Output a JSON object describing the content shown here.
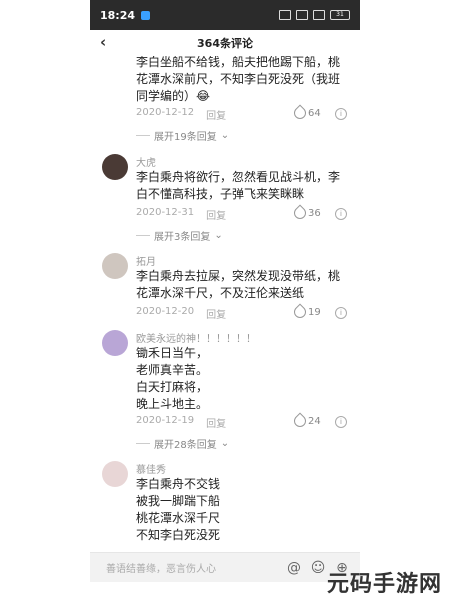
{
  "status": {
    "time": "18:24",
    "battery": "31"
  },
  "header": {
    "title": "364条评论"
  },
  "comments": [
    {
      "user": "",
      "text": "李白坐船不给钱，船夫把他踢下船，桃花潭水深前尺，不知李白死没死（我班同学编的）😂",
      "date": "2020-12-12",
      "reply": "回复",
      "likes": "64",
      "expand": "展开19条回复"
    },
    {
      "user": "大虎",
      "text": "李白乘舟将欲行，忽然看见战斗机，李白不懂高科技，子弹飞来笑眯眯",
      "date": "2020-12-31",
      "reply": "回复",
      "likes": "36",
      "expand": "展开3条回复"
    },
    {
      "user": "拓月",
      "text": "李白乘舟去拉屎，突然发现没带纸，桃花潭水深千尺，不及汪伦来送纸",
      "date": "2020-12-20",
      "reply": "回复",
      "likes": "19",
      "expand": ""
    },
    {
      "user": "欧美永远的神！！！！！！",
      "text": "锄禾日当午，\n老师真辛苦。\n白天打麻将，\n晚上斗地主。",
      "date": "2020-12-19",
      "reply": "回复",
      "likes": "24",
      "expand": "展开28条回复"
    },
    {
      "user": "慕佳秀",
      "text": "李白乘舟不交钱\n被我一脚踹下船\n桃花潭水深千尺\n不知李白死没死",
      "date": "",
      "reply": "",
      "likes": "",
      "expand": ""
    }
  ],
  "bottom": {
    "placeholder": "善语结善缘，恶言伤人心"
  },
  "watermark": "元码手游网"
}
